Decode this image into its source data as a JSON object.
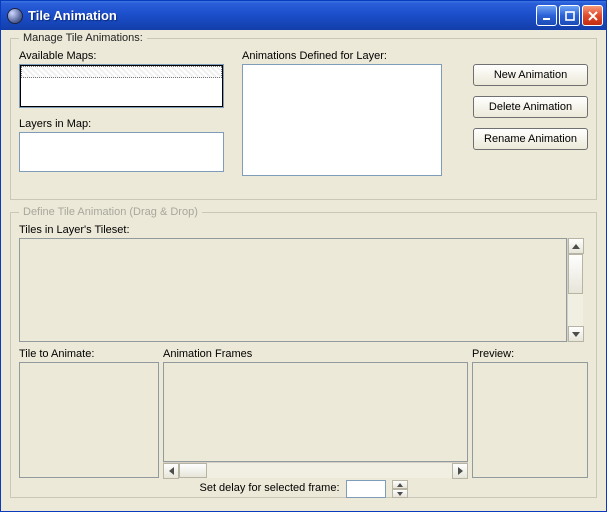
{
  "window": {
    "title": "Tile Animation"
  },
  "manage": {
    "legend": "Manage Tile Animations:",
    "available_maps_label": "Available Maps:",
    "layers_label": "Layers in Map:",
    "animations_label": "Animations Defined for Layer:",
    "buttons": {
      "new": "New Animation",
      "delete": "Delete Animation",
      "rename": "Rename Animation"
    }
  },
  "define": {
    "legend": "Define Tile Animation (Drag & Drop)",
    "tiles_label": "Tiles in Layer's Tileset:",
    "tile_to_animate_label": "Tile to Animate:",
    "frames_label": "Animation Frames",
    "preview_label": "Preview:",
    "delay_label": "Set delay for selected frame:",
    "delay_value": ""
  }
}
